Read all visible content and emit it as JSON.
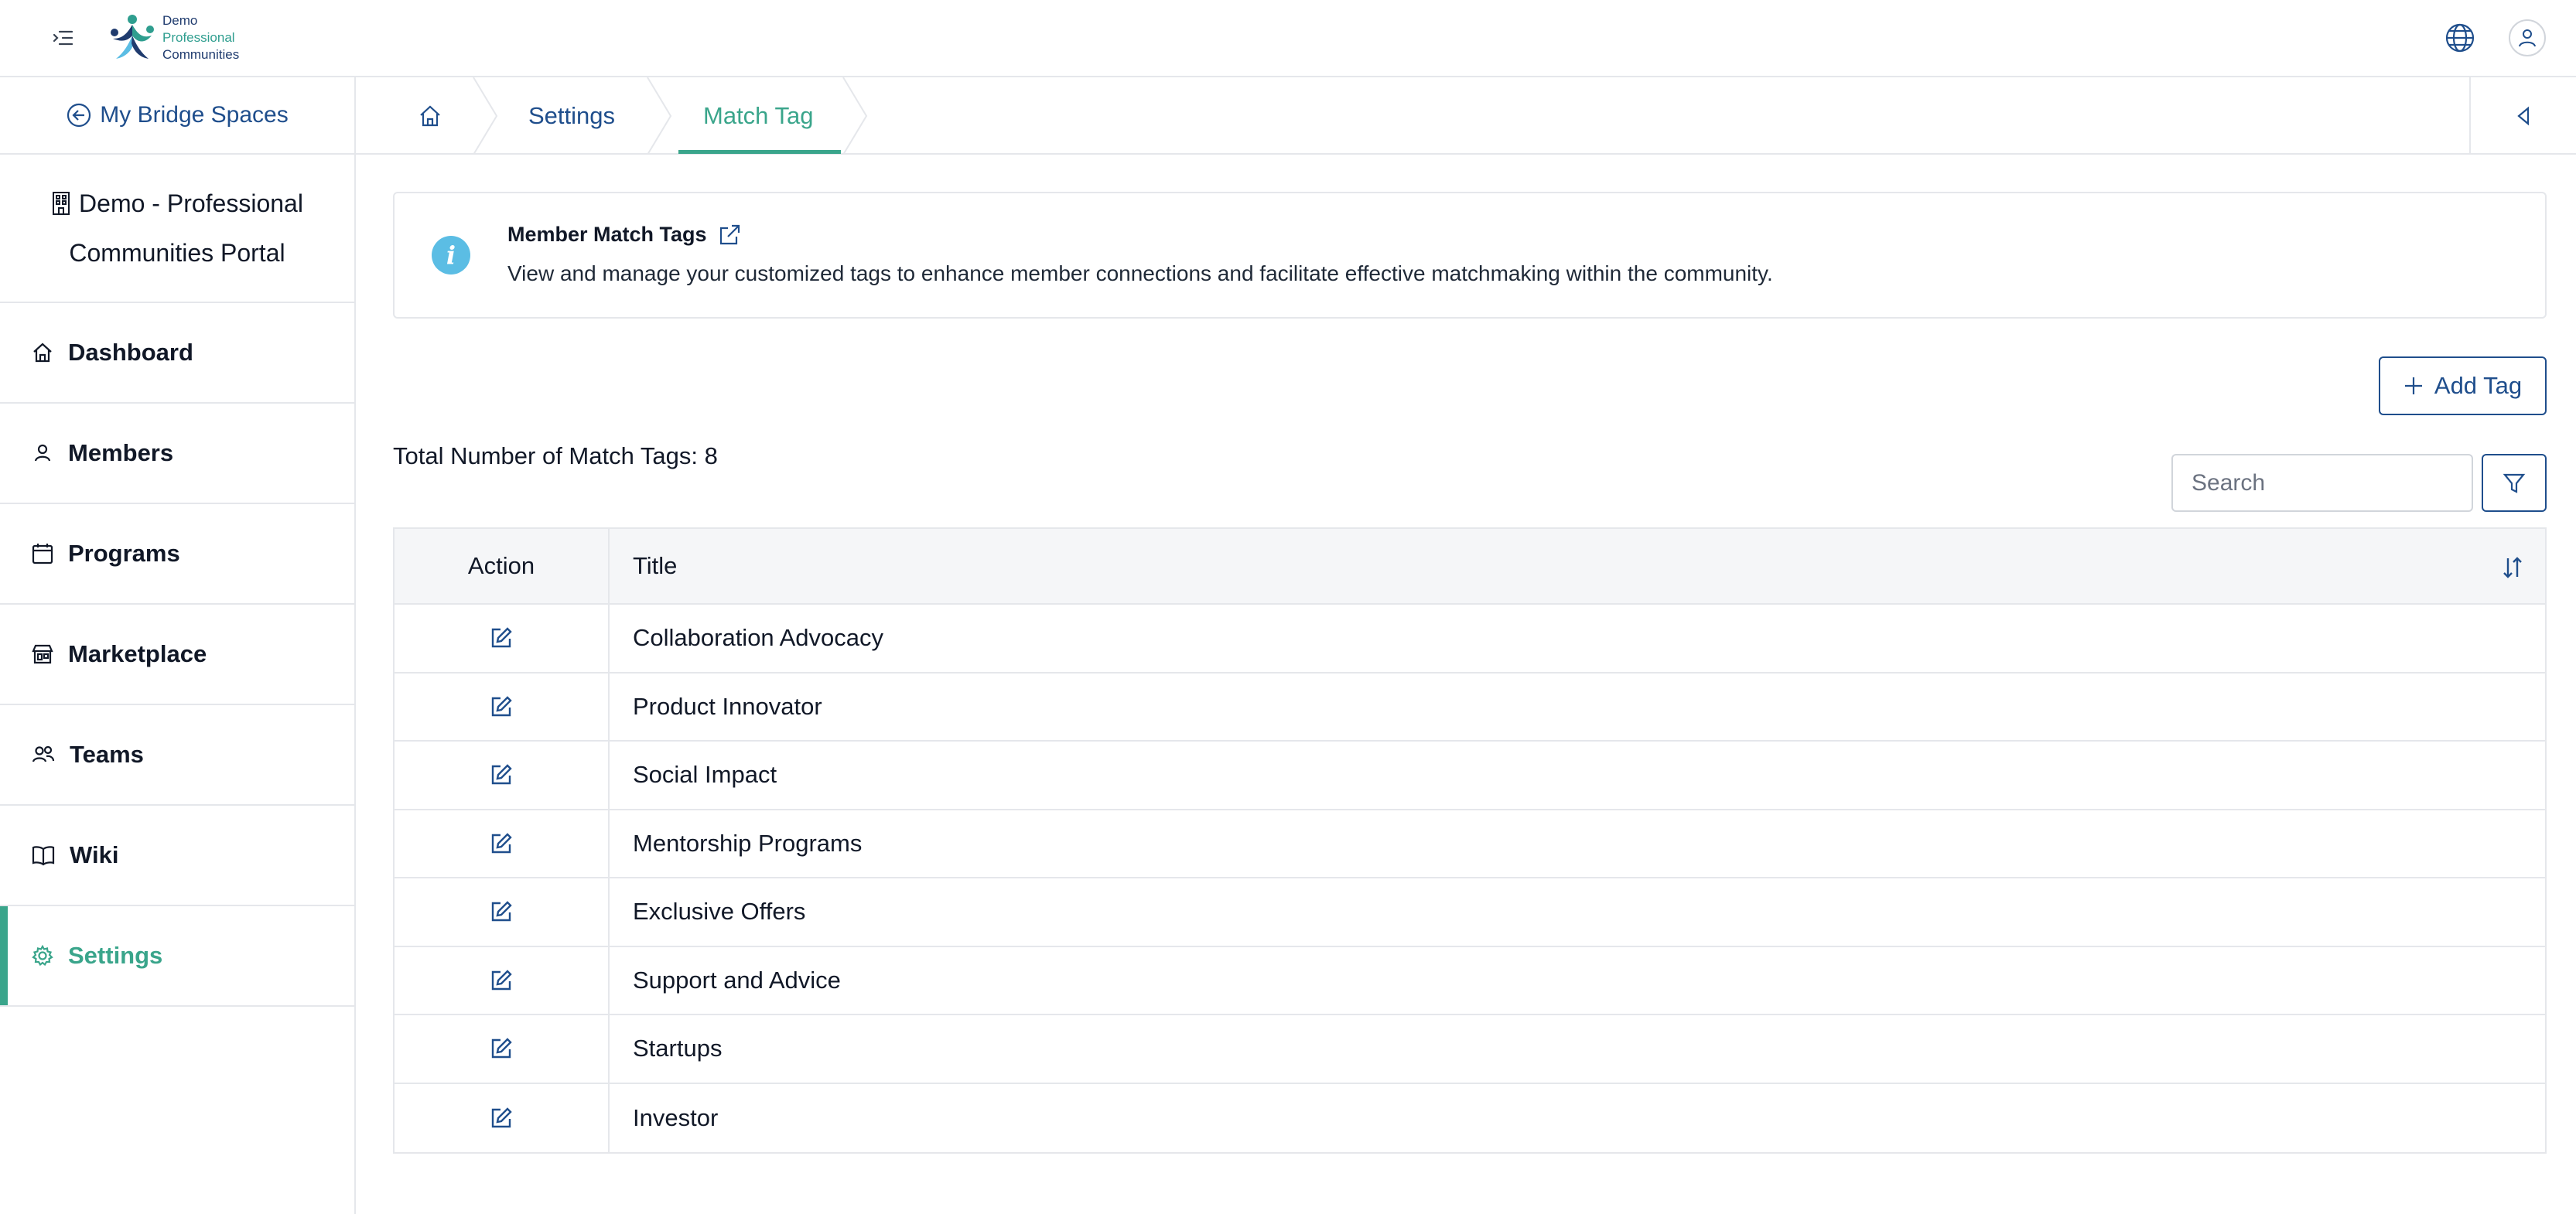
{
  "header": {
    "logo_lines": [
      "Demo",
      "Professional",
      "Communities"
    ]
  },
  "sidebar": {
    "back_label": "My Bridge Spaces",
    "space_name_line1": "Demo - Professional",
    "space_name_line2": "Communities Portal",
    "items": [
      {
        "label": "Dashboard",
        "icon": "home-icon"
      },
      {
        "label": "Members",
        "icon": "user-icon"
      },
      {
        "label": "Programs",
        "icon": "calendar-icon"
      },
      {
        "label": "Marketplace",
        "icon": "store-icon"
      },
      {
        "label": "Teams",
        "icon": "users-icon"
      },
      {
        "label": "Wiki",
        "icon": "book-icon"
      },
      {
        "label": "Settings",
        "icon": "gear-icon",
        "active": true
      }
    ]
  },
  "breadcrumb": {
    "items": [
      "Settings",
      "Match Tag"
    ]
  },
  "info": {
    "title": "Member Match Tags",
    "description": "View and manage your customized tags to enhance member connections and facilitate effective matchmaking within the community."
  },
  "toolbar": {
    "add_tag_label": "Add Tag",
    "total_label": "Total Number of Match Tags: 8",
    "search_placeholder": "Search"
  },
  "table": {
    "columns": [
      "Action",
      "Title"
    ],
    "rows": [
      "Collaboration Advocacy",
      "Product Innovator",
      "Social Impact",
      "Mentorship Programs",
      "Exclusive Offers",
      "Support and Advice",
      "Startups",
      "Investor"
    ]
  },
  "colors": {
    "primary": "#1f4e8c",
    "accent": "#3aa58b",
    "info": "#5bbde4",
    "border": "#e5e7eb"
  }
}
